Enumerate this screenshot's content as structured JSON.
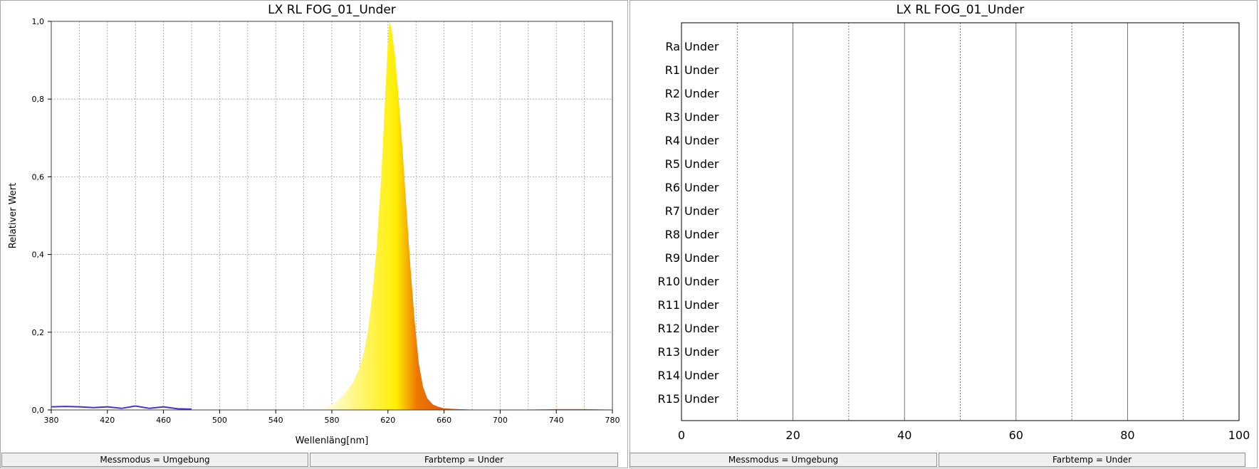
{
  "colors": {
    "gradient_yellow": "#ffee00",
    "gradient_orange": "#ee7700",
    "gradient_red": "#e05a0a",
    "blue_noise": "#4433cc",
    "grid": "#a0a0a0",
    "frame": "#404040"
  },
  "status": {
    "left_mode": "Messmodus = Umgebung",
    "left_temp": "Farbtemp = Under",
    "right_mode": "Messmodus = Umgebung",
    "right_temp": "Farbtemp = Under"
  },
  "chart_data": [
    {
      "type": "area",
      "title": "LX RL FOG_01_Under",
      "xlabel": "Wellenläng[nm]",
      "ylabel": "Relativer Wert",
      "xlim": [
        380,
        780
      ],
      "ylim": [
        0,
        1.0
      ],
      "x_ticks": [
        {
          "v": 380,
          "label": "380"
        },
        {
          "v": 420,
          "label": "420"
        },
        {
          "v": 460,
          "label": "460"
        },
        {
          "v": 500,
          "label": "500"
        },
        {
          "v": 540,
          "label": "540"
        },
        {
          "v": 580,
          "label": "580"
        },
        {
          "v": 620,
          "label": "620"
        },
        {
          "v": 660,
          "label": "660"
        },
        {
          "v": 700,
          "label": "700"
        },
        {
          "v": 740,
          "label": "740"
        },
        {
          "v": 780,
          "label": "780"
        }
      ],
      "y_ticks": [
        {
          "v": 0,
          "label": "0,0"
        },
        {
          "v": 0.2,
          "label": "0,2"
        },
        {
          "v": 0.4,
          "label": "0,4"
        },
        {
          "v": 0.6,
          "label": "0,6"
        },
        {
          "v": 0.8,
          "label": "0,8"
        },
        {
          "v": 1.0,
          "label": "1,0"
        }
      ],
      "grid": true,
      "x": [
        380,
        390,
        400,
        410,
        420,
        430,
        440,
        450,
        460,
        470,
        480,
        490,
        500,
        510,
        520,
        530,
        540,
        550,
        560,
        570,
        575,
        580,
        585,
        590,
        595,
        600,
        603,
        606,
        609,
        612,
        615,
        617,
        619,
        620,
        621,
        622,
        623,
        625,
        627,
        630,
        633,
        636,
        639,
        642,
        645,
        648,
        652,
        656,
        660,
        670,
        680,
        700,
        720,
        740,
        760,
        780
      ],
      "y": [
        0.008,
        0.009,
        0.008,
        0.006,
        0.008,
        0.004,
        0.01,
        0.004,
        0.008,
        0.003,
        0.002,
        0.001,
        0.001,
        0.001,
        0.001,
        0.001,
        0.001,
        0.002,
        0.003,
        0.005,
        0.008,
        0.014,
        0.026,
        0.045,
        0.07,
        0.11,
        0.15,
        0.21,
        0.3,
        0.42,
        0.59,
        0.73,
        0.88,
        0.95,
        1.0,
        0.99,
        0.97,
        0.91,
        0.83,
        0.69,
        0.53,
        0.37,
        0.23,
        0.12,
        0.06,
        0.03,
        0.014,
        0.008,
        0.004,
        0.002,
        0.001,
        0.001,
        0.001,
        0.002,
        0.002,
        0.001
      ]
    },
    {
      "type": "bar",
      "title": "LX RL FOG_01_Under",
      "categories": [
        "Ra",
        "R1",
        "R2",
        "R3",
        "R4",
        "R5",
        "R6",
        "R7",
        "R8",
        "R9",
        "R10",
        "R11",
        "R12",
        "R13",
        "R14",
        "R15"
      ],
      "value_labels": [
        "Under",
        "Under",
        "Under",
        "Under",
        "Under",
        "Under",
        "Under",
        "Under",
        "Under",
        "Under",
        "Under",
        "Under",
        "Under",
        "Under",
        "Under",
        "Under"
      ],
      "xlim": [
        0,
        100
      ],
      "x_ticks": [
        {
          "v": 0,
          "label": "0"
        },
        {
          "v": 20,
          "label": "20"
        },
        {
          "v": 40,
          "label": "40"
        },
        {
          "v": 60,
          "label": "60"
        },
        {
          "v": 80,
          "label": "80"
        },
        {
          "v": 100,
          "label": "100"
        }
      ],
      "grid": true
    }
  ]
}
